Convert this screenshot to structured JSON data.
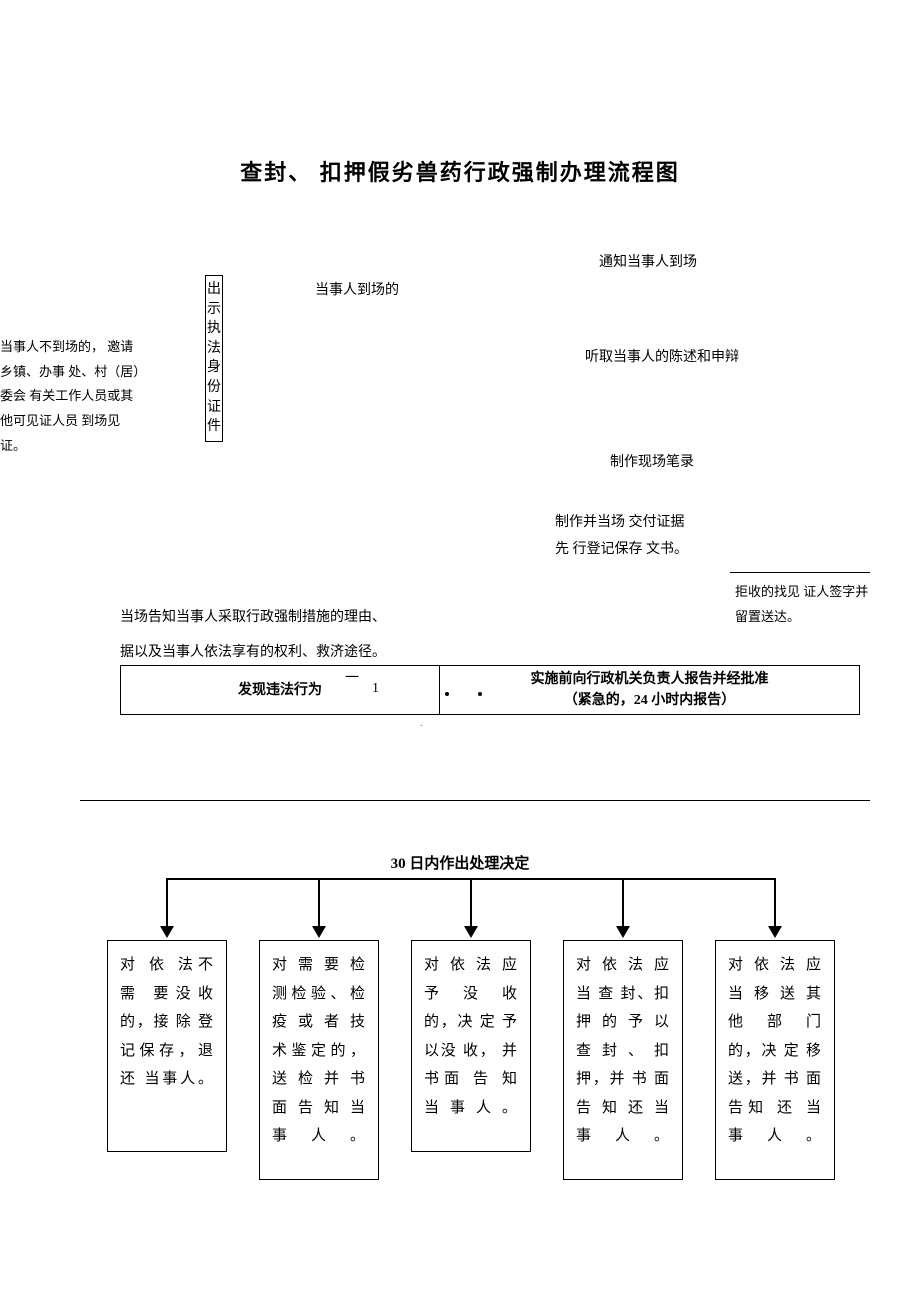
{
  "title": "查封、 扣押假劣兽药行政强制办理流程图",
  "side_note": "当事人不到场的， 邀请乡镇、办事 处、村（居）委会 有关工作人员或其他可见证人员 到场见证。",
  "vert_box": "出示执法身份证件",
  "party_present": "当事人到场的",
  "notify_party": "通知当事人到场",
  "listen_statement": "听取当事人的陈述和申辩",
  "make_record": "制作现场笔录",
  "make_deliver": "制作并当场 交付证据先 行登记保存 文书。",
  "refuse_sign": "拒收的找见 证人签字并 留置送达。",
  "inform_reason1": "当场告知当事人采取行政强制措施的理由、",
  "inform_reason2": "据以及当事人依法享有的权利、救济途径。",
  "wide_left": "发现违法行为",
  "wide_right_l1": "实施前向行政机关负责人报告并经批准",
  "wide_right_l2": "（紧急的，24 小时内报告）",
  "decision_title": "30 日内作出处理决定",
  "results": [
    "对 依 法不 需 要没收的，接 除 登记保存，退 还 当事人。",
    "对 需 要 检测检验、检疫 或 者 技术鉴定的，送 检 并 书面 告 知 当事人。",
    "对 依 法 应予 没 收 的，决 定 予 以没 收， 并书面 告 知 当事人。",
    "对 依 法 应当 查 封、扣押 的 予 以查 封 、 扣押，并 书 面告 知 还 当事人。",
    "对 依 法 应当 移 送 其他 部 门 的，决 定 移 送，并 书 面 告知 还 当 事人。"
  ]
}
